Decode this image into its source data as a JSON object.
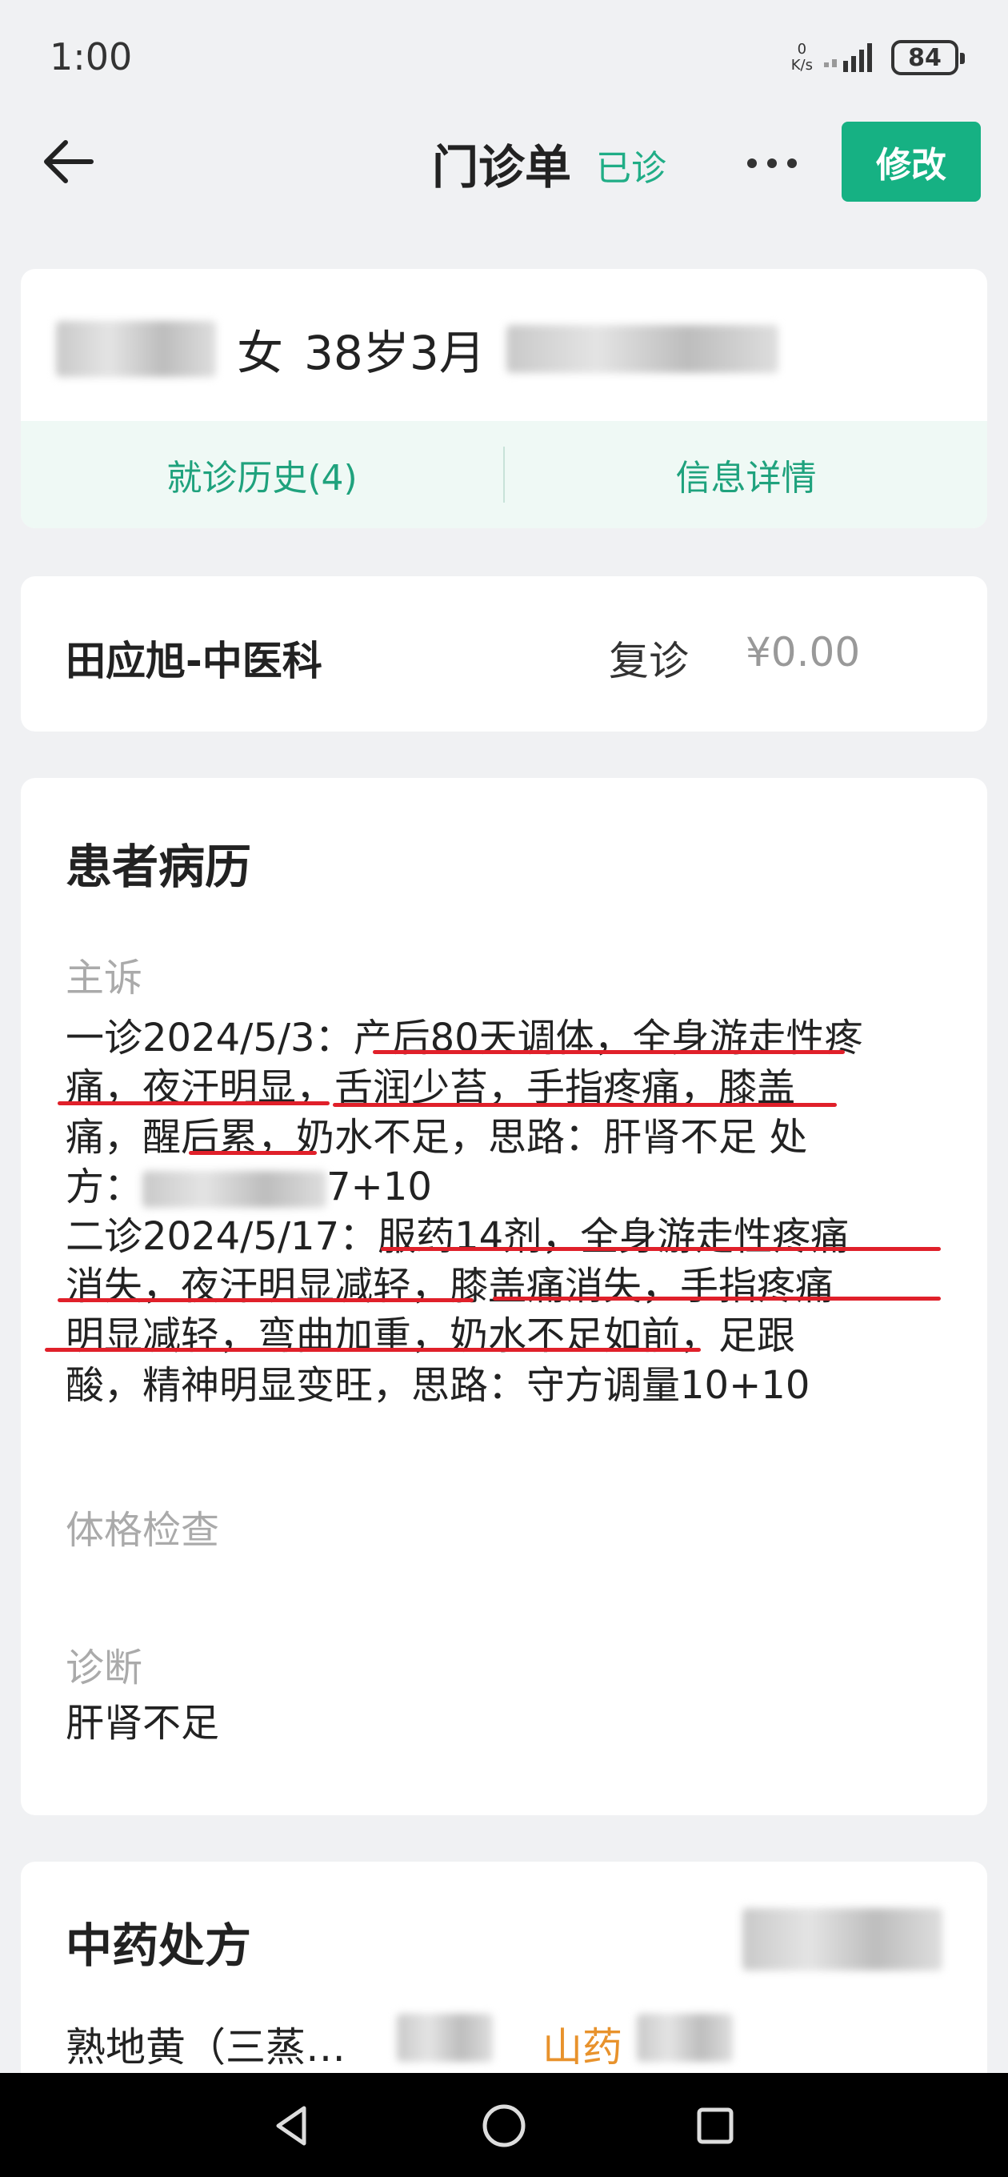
{
  "status_bar": {
    "time": "1:00",
    "net_speed_value": "0",
    "net_speed_unit": "K/s",
    "battery": "84"
  },
  "header": {
    "title": "门诊单",
    "status": "已诊",
    "edit_label": "修改"
  },
  "patient": {
    "gender": "女",
    "age": "38岁3月",
    "tabs": [
      "就诊历史(4)",
      "信息详情"
    ]
  },
  "visit": {
    "doctor": "田应旭-中医科",
    "type": "复诊",
    "fee": "¥0.00"
  },
  "record": {
    "title": "患者病历",
    "complaint_label": "主诉",
    "complaint_lines": [
      "一诊2024/5/3：产后80天调体，全身游走性疼",
      "痛，夜汗明显，舌润少苔，手指疼痛，膝盖",
      "痛，醒后累，奶水不足，思路：肝肾不足 处",
      "7+10",
      "二诊2024/5/17：服药14剂，全身游走性疼痛",
      "消失，夜汗明显减轻，膝盖痛消失，手指疼痛",
      "明显减轻，弯曲加重，奶水不足如前，足跟",
      "酸，精神明显变旺，思路：守方调量10+10"
    ],
    "complaint_line4_prefix": "方：",
    "exam_label": "体格检查",
    "diagnosis_label": "诊断",
    "diagnosis": "肝肾不足"
  },
  "prescription": {
    "title": "中药处方",
    "herbs": [
      "熟地黄（三蒸…",
      "山药"
    ]
  },
  "colors": {
    "accent": "#16b183",
    "accent_text": "#20ad86",
    "underline": "#e0202a",
    "herb_highlight": "#e8922c"
  },
  "icons": {
    "back": "back-arrow-icon",
    "more": "more-dots-icon",
    "nav_back": "triangle-back-icon",
    "nav_home": "circle-home-icon",
    "nav_recent": "square-recent-icon"
  }
}
